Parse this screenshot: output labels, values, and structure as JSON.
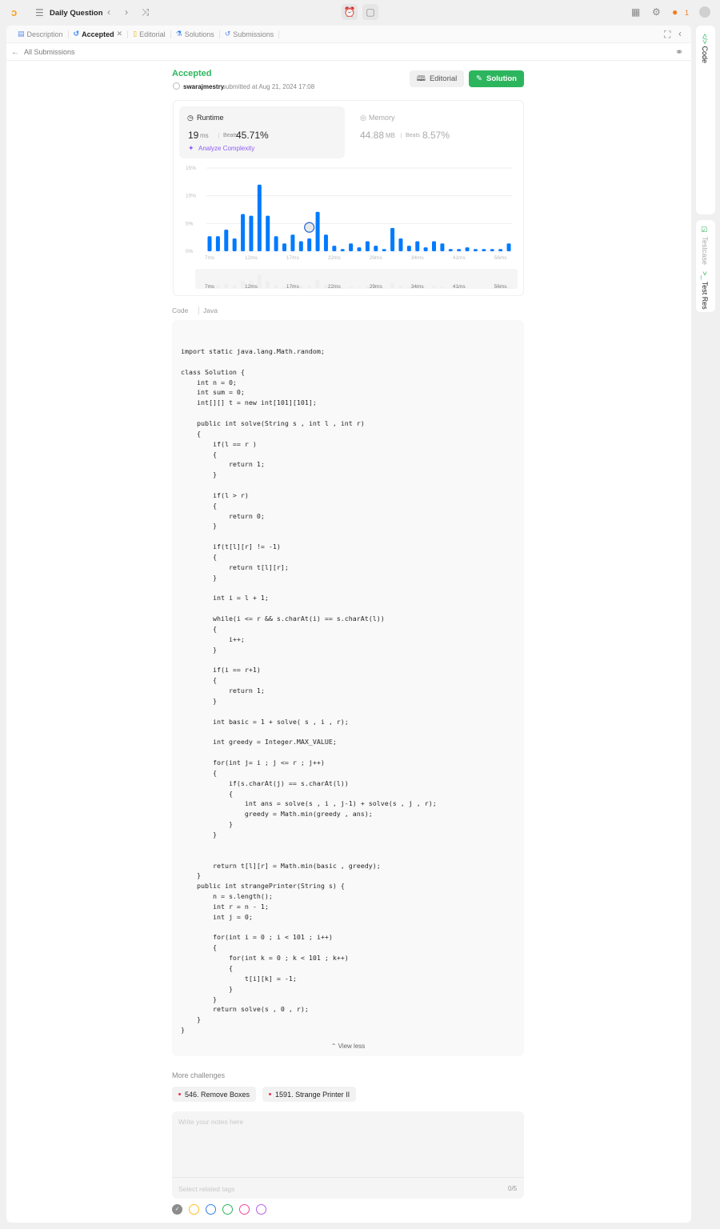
{
  "topbar": {
    "title": "Daily Question",
    "streak": "1"
  },
  "tabs": [
    {
      "label": "Description",
      "icon": "description-icon"
    },
    {
      "label": "Accepted",
      "icon": "history-icon"
    },
    {
      "label": "Editorial",
      "icon": "book-icon"
    },
    {
      "label": "Solutions",
      "icon": "flask-icon"
    },
    {
      "label": "Submissions",
      "icon": "history-icon"
    }
  ],
  "back_link": "All Submissions",
  "submission": {
    "status": "Accepted",
    "user": "swarajmestry",
    "submitted": "submitted at Aug 21, 2024 17:08",
    "editorial_label": "Editorial",
    "solution_label": "Solution",
    "runtime": {
      "label": "Runtime",
      "value": "19",
      "unit": "ms",
      "beats_label": "Beats",
      "beats": "45.71%"
    },
    "analyze": "Analyze Complexity",
    "memory": {
      "label": "Memory",
      "value": "44.88",
      "unit": "MB",
      "beats_label": "Beats",
      "beats": "8.57%"
    }
  },
  "chart_data": {
    "type": "bar",
    "ylabel": "",
    "xlabel": "",
    "yticks": [
      "0%",
      "5%",
      "10%",
      "15%"
    ],
    "ylim": [
      0,
      15
    ],
    "xtick_labels": [
      "7ms",
      "12ms",
      "17ms",
      "22ms",
      "29ms",
      "34ms",
      "41ms",
      "56ms"
    ],
    "values": [
      2.7,
      2.7,
      3.9,
      2.3,
      6.7,
      6.4,
      12.0,
      6.4,
      2.7,
      1.4,
      3.0,
      1.8,
      2.3,
      7.1,
      3.0,
      1.0,
      0.4,
      1.4,
      0.7,
      1.8,
      1.0,
      0.4,
      4.2,
      2.3,
      1.0,
      1.8,
      0.7,
      1.8,
      1.4,
      0.4,
      0.4,
      0.7,
      0.4,
      0.4,
      0.4,
      0.4,
      1.4
    ],
    "user_bar_index": 12,
    "color": "#007aff"
  },
  "code": {
    "label": "Code",
    "language": "Java",
    "lines": [
      "import static java.lang.Math.random;",
      "",
      "class Solution {",
      "    int n = 0;",
      "    int sum = 0;",
      "    int[][] t = new int[101][101];",
      "",
      "    public int solve(String s , int l , int r)",
      "    {",
      "        if(l == r )",
      "        {",
      "            return 1;",
      "        }",
      "",
      "        if(l > r)",
      "        {",
      "            return 0;",
      "        }",
      "",
      "        if(t[l][r] != -1)",
      "        {",
      "            return t[l][r];",
      "        }",
      "",
      "        int i = l + 1;",
      "",
      "        while(i <= r && s.charAt(i) == s.charAt(l))",
      "        {",
      "            i++;",
      "        }",
      "",
      "        if(i == r+1)",
      "        {",
      "            return 1;",
      "        }",
      "",
      "        int basic = 1 + solve( s , i , r);",
      "",
      "        int greedy = Integer.MAX_VALUE;",
      "",
      "        for(int j= i ; j <= r ; j++)",
      "        {",
      "            if(s.charAt(j) == s.charAt(l))",
      "            {",
      "                int ans = solve(s , i , j-1) + solve(s , j , r);",
      "                greedy = Math.min(greedy , ans);",
      "            }",
      "        }",
      "",
      "",
      "        return t[l][r] = Math.min(basic , greedy);",
      "    }",
      "    public int strangePrinter(String s) {",
      "        n = s.length();",
      "        int r = n - 1;",
      "        int j = 0;",
      "",
      "        for(int i = 0 ; i < 101 ; i++)",
      "        {",
      "            for(int k = 0 ; k < 101 ; k++)",
      "            {",
      "                t[i][k] = -1;",
      "            }",
      "        }",
      "        return solve(s , 0 , r);",
      "    }",
      "}"
    ],
    "view_less": "View less"
  },
  "more_challenges": {
    "label": "More challenges",
    "items": [
      "546. Remove Boxes",
      "1591. Strange Printer II"
    ]
  },
  "notes": {
    "placeholder": "Write your notes here",
    "tags_placeholder": "Select related tags",
    "tag_count": "0/5"
  },
  "color_tags": [
    "#8c8c8c",
    "#ffc01e",
    "#2f80ed",
    "#2db55d",
    "#ef47a0",
    "#b85ee8"
  ],
  "side": {
    "code": "Code",
    "testcase": "Testcase",
    "test_result": "Test Res"
  }
}
